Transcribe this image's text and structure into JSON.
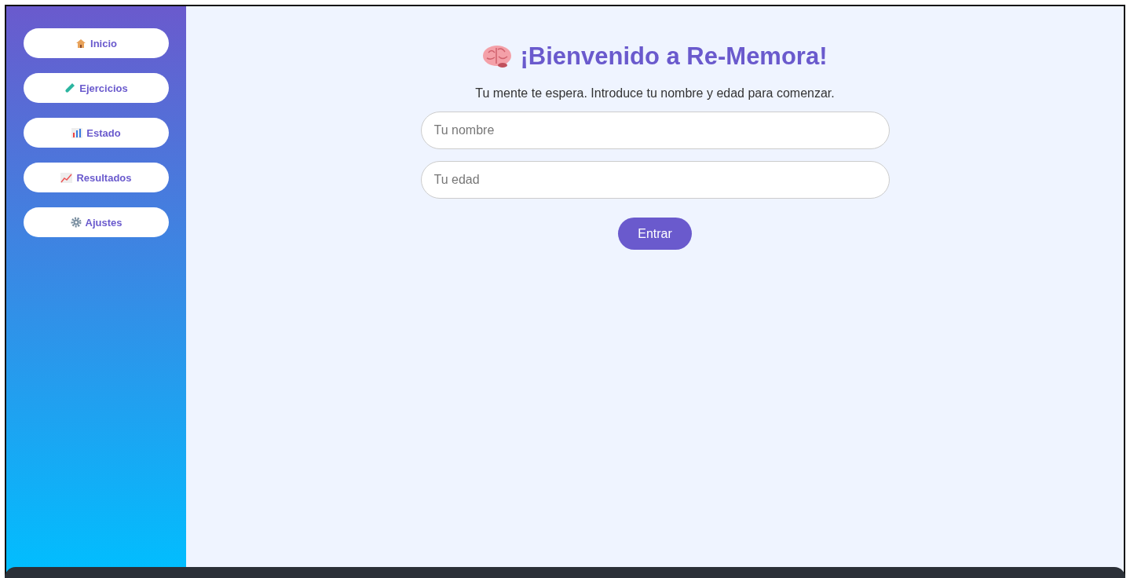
{
  "sidebar": {
    "items": [
      {
        "label": "Inicio"
      },
      {
        "label": "Ejercicios"
      },
      {
        "label": "Estado"
      },
      {
        "label": "Resultados"
      },
      {
        "label": "Ajustes"
      }
    ]
  },
  "main": {
    "title": "¡Bienvenido a Re-Memora!",
    "subtitle": "Tu mente te espera. Introduce tu nombre y edad para comenzar.",
    "fields": [
      {
        "placeholder": "Tu nombre"
      },
      {
        "placeholder": "Tu edad"
      }
    ],
    "button": "Entrar"
  }
}
